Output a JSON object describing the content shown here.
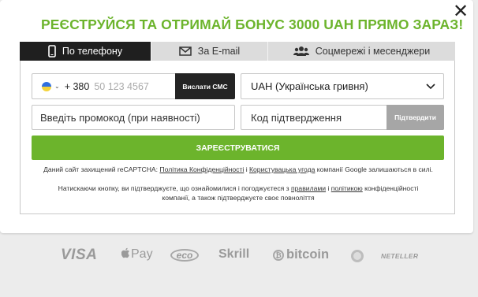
{
  "modal": {
    "headline": "РЕЄСТРУЙСЯ ТА ОТРИМАЙ БОНУС 3000 UAH ПРЯМО ЗАРАЗ!",
    "close_symbol": "✕"
  },
  "tabs": [
    {
      "label": "По телефону",
      "icon": "phone-icon",
      "active": true
    },
    {
      "label": "За E-mail",
      "icon": "mail-icon",
      "active": false
    },
    {
      "label": "Соцмережі і месенджери",
      "icon": "users-icon",
      "active": false
    }
  ],
  "form": {
    "phone_prefix": "+ 380",
    "phone_placeholder": "50 123 4567",
    "send_sms_label": "Вислати СМС",
    "currency_value": "UAH (Українська гривня)",
    "promo_placeholder": "Введіть промокод (при наявності)",
    "code_placeholder": "Код підтвердження",
    "confirm_label": "Підтвердити",
    "register_label": "ЗАРЕЄСТРУВАТИСЯ"
  },
  "legal": {
    "recaptcha_prefix": "Даний сайт захищений reCAPTCHA: ",
    "privacy_link": "Політика Конфіденційності",
    "and1": " і ",
    "terms_link": "Користувацька угода",
    "recaptcha_suffix": " компанії Google залишаються в силі.",
    "consent_prefix": "Натискаючи кнопку, ви підтверджуєте, що ознайомилися і погоджуєтеся з ",
    "rules_link": "правилами",
    "and2": " і ",
    "policy_link": "політикою",
    "consent_suffix": " конфіденційності компанії, а також підтверджуєте своє повноліття"
  },
  "payments": {
    "visa": "VISA",
    "applepay": "Pay",
    "eco": "eco",
    "skrill": "Skrill",
    "bitcoin_symbol": "₿",
    "bitcoin": "bitcoin",
    "neteller": "NETELLER"
  },
  "colors": {
    "brand_green": "#6cb42c",
    "dark": "#1f1f1f",
    "muted_button": "#a6a6a6"
  }
}
